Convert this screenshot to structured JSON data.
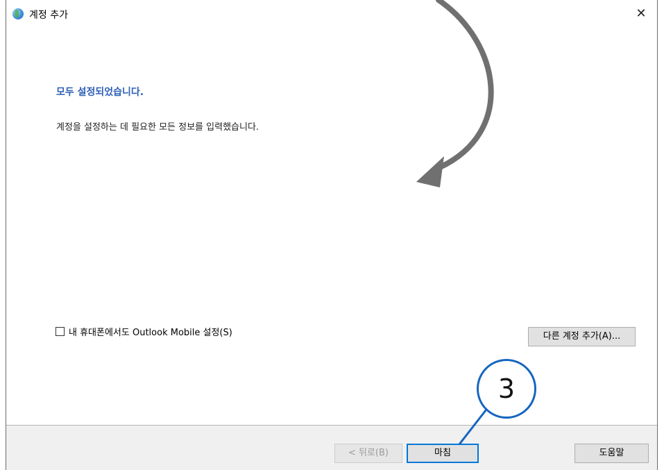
{
  "window": {
    "title": "계정 추가",
    "close_glyph": "✕"
  },
  "main": {
    "heading": "모두 설정되었습니다.",
    "description": "계정을 설정하는 데 필요한 모든 정보를 입력했습니다.",
    "mobile_checkbox": {
      "label": "내 휴대폰에서도 Outlook Mobile 설정(S)",
      "checked": false
    },
    "add_account_button": "다른 계정 추가(A)..."
  },
  "footer": {
    "back_button": "< 뒤로(B)",
    "finish_button": "마침",
    "help_button": "도움말"
  },
  "annotation": {
    "step_number": "3",
    "callout_color": "#1565c0",
    "arrow_color": "#707070"
  },
  "colors": {
    "heading": "#2f60b8",
    "focus_border": "#0078d7",
    "footer_bg": "#f0f0f0"
  }
}
